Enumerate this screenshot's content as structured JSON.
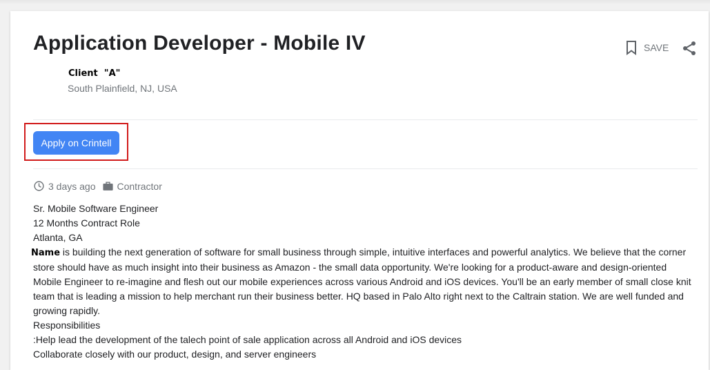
{
  "job": {
    "title": "Application Developer - Mobile IV",
    "company": "Client  \"A\"",
    "location": "South Plainfield, NJ, USA"
  },
  "actions": {
    "save_label": "SAVE",
    "apply_label": "Apply on Crintell"
  },
  "icons": {
    "save": "bookmark-icon",
    "share": "share-icon",
    "posted": "clock-icon",
    "type": "briefcase-icon"
  },
  "colors": {
    "apply_button": "#4285f4",
    "highlight_box": "#d11a1a"
  },
  "meta": {
    "posted": "3 days ago",
    "employment_type": "Contractor"
  },
  "description": {
    "line1": "Sr. Mobile Software Engineer",
    "line2": "12 Months Contract Role",
    "line3": "Atlanta, GA",
    "lead_word": "Name",
    "paragraph": " is building the next generation of software for small business through simple, intuitive interfaces and powerful analytics. We believe that the corner store should have as much insight into their business as Amazon - the small data opportunity. We're looking for a product-aware and design-oriented Mobile Engineer to re-imagine and flesh out our mobile experiences across various Android and iOS devices. You'll be an early member of small close knit team that is leading a mission to help merchant run their business better. HQ based in Palo Alto right next to the Caltrain station. We are well funded and growing rapidly.",
    "responsibilities_heading": "Responsibilities",
    "resp1": ":Help lead the development of the talech point of sale application across all Android and iOS devices",
    "resp2": "Collaborate closely with our product, design, and server engineers"
  }
}
